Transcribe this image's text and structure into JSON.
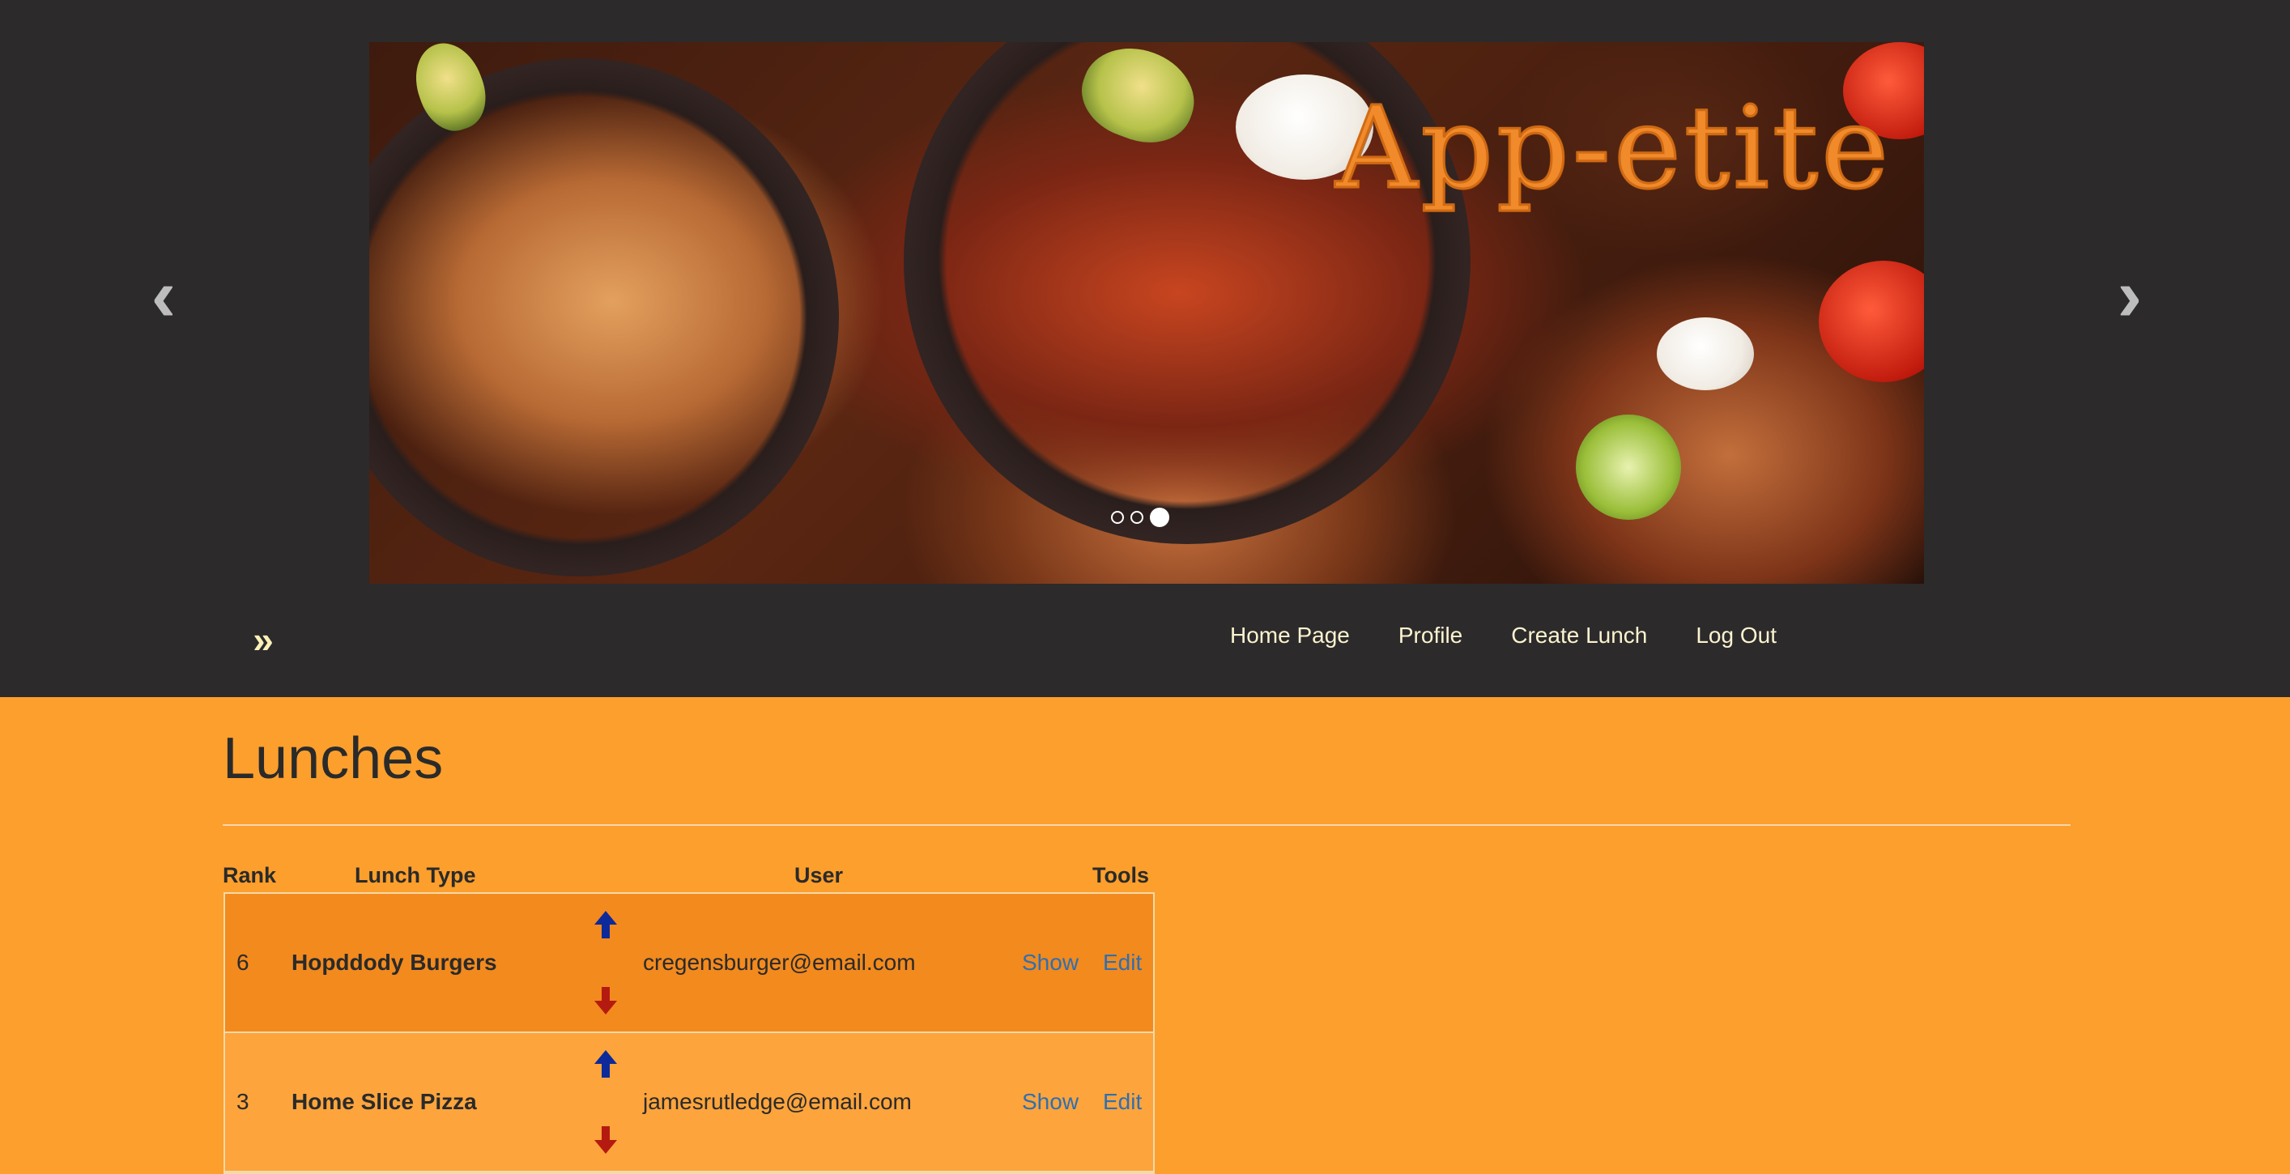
{
  "carousel": {
    "logo_text": "App-etite",
    "prev_label": "‹",
    "next_label": "›",
    "indicators": [
      false,
      false,
      true
    ],
    "colors": {
      "logo": "#f08a2a"
    }
  },
  "navbar": {
    "brand_icon": "double-chevron-right-icon",
    "brand_glyph": "»",
    "links": [
      "Home Page",
      "Profile",
      "Create Lunch",
      "Log Out"
    ]
  },
  "page": {
    "title": "Lunches",
    "background": "#fd9f2c"
  },
  "table": {
    "headers": {
      "rank": "Rank",
      "lunch_type": "Lunch Type",
      "user": "User",
      "tools": "Tools"
    },
    "rows": [
      {
        "rank": "6",
        "lunch_type": "Hopddody Burgers",
        "user": "cregensburger@email.com",
        "show": "Show",
        "edit": "Edit"
      },
      {
        "rank": "3",
        "lunch_type": "Home Slice Pizza",
        "user": "jamesrutledge@email.com",
        "show": "Show",
        "edit": "Edit"
      }
    ],
    "colors": {
      "upvote": "#0d2a9a",
      "downvote": "#b51a10",
      "link": "#2f6fb0"
    }
  }
}
